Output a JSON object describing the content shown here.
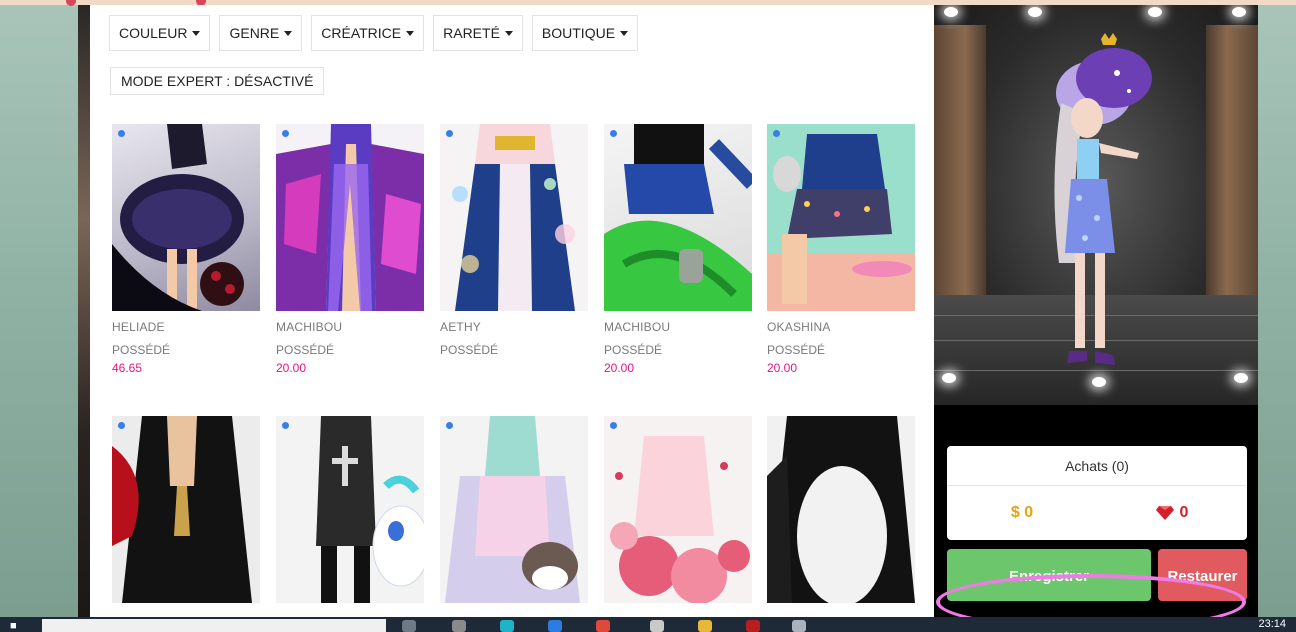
{
  "filters": [
    {
      "label": "COULEUR"
    },
    {
      "label": "GENRE"
    },
    {
      "label": "CRÉATRICE"
    },
    {
      "label": "RARETÉ"
    },
    {
      "label": "BOUTIQUE"
    }
  ],
  "mode_label": "MODE EXPERT : DÉSACTIVÉ",
  "items_row1": [
    {
      "creator": "HELIADE",
      "status": "POSSÉDÉ",
      "price": "46.65"
    },
    {
      "creator": "MACHIBOU",
      "status": "POSSÉDÉ",
      "price": "20.00"
    },
    {
      "creator": "AETHY",
      "status": "POSSÉDÉ",
      "price": ""
    },
    {
      "creator": "MACHIBOU",
      "status": "POSSÉDÉ",
      "price": "20.00"
    },
    {
      "creator": "OKASHINA",
      "status": "POSSÉDÉ",
      "price": "20.00"
    }
  ],
  "cart": {
    "title": "Achats (0)",
    "dollars": "$ 0",
    "gems": "0"
  },
  "buttons": {
    "save": "Enregistrer",
    "restore": "Restaurer"
  },
  "taskbar": {
    "clock": "23:14"
  },
  "colors": {
    "price": "#e0187f",
    "save": "#6cc76c",
    "restore": "#e05a5f",
    "new_dot": "#3b7de8",
    "annotation": "#f07be6"
  }
}
